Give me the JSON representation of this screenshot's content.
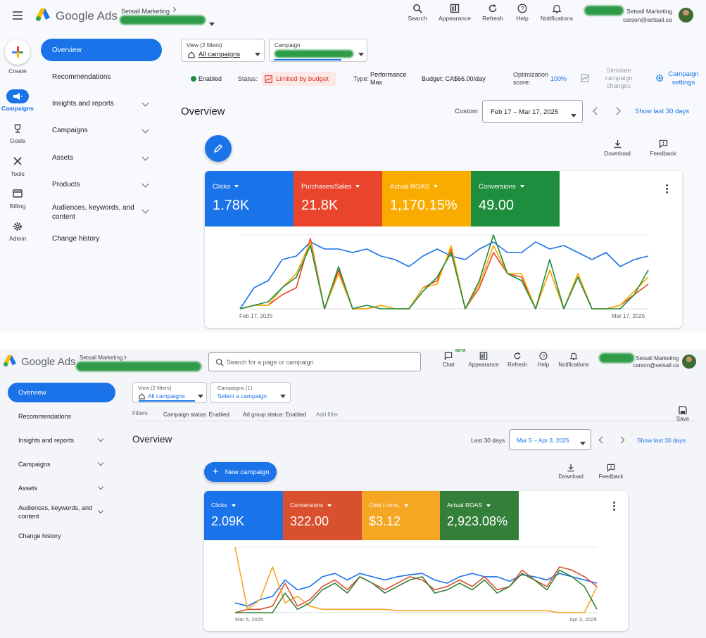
{
  "top": {
    "brand": "Google Ads",
    "account_name": "Setsail Marketing",
    "toolbar": [
      "Search",
      "Appearance",
      "Refresh",
      "Help",
      "Notifications"
    ],
    "user_name": "Setsail Marketing",
    "user_email": "carson@setsail.ca",
    "rail": [
      "Create",
      "Campaigns",
      "Goals",
      "Tools",
      "Billing",
      "Admin"
    ],
    "nav": {
      "overview": "Overview",
      "recommendations": "Recommendations",
      "insights": "Insights and reports",
      "campaigns": "Campaigns",
      "assets": "Assets",
      "products": "Products",
      "audiences": "Audiences, keywords, and content",
      "change_history": "Change history"
    },
    "view_filter": {
      "label": "View (2 filters)",
      "value": "All campaigns"
    },
    "campaign_select": {
      "label": "Campaign"
    },
    "status_row": {
      "enabled": "Enabled",
      "status_label": "Status:",
      "status_value": "Limited by budget",
      "type_label": "Type:",
      "type_value": "Performance Max",
      "budget": "Budget: CA$66.00/day",
      "opt_label": "Optimization score:",
      "opt_value": "100%",
      "simulate": "Simulate campaign changes",
      "settings": "Campaign settings"
    },
    "overview_title": "Overview",
    "date_preset": "Custom",
    "date_range": "Feb 17 – Mar 17, 2025",
    "show_last": "Show last 30 days",
    "download": "Download",
    "feedback": "Feedback",
    "tiles": [
      {
        "label": "Clicks",
        "value": "1.78K",
        "color": "#1a73e8"
      },
      {
        "label": "Purchases/Sales",
        "value": "21.8K",
        "color": "#e8452c"
      },
      {
        "label": "Actual ROAS",
        "value": "1,170.15%",
        "color": "#f9ab00"
      },
      {
        "label": "Conversions",
        "value": "49.00",
        "color": "#1e8e3e"
      }
    ],
    "x_start": "Feb 17, 2025",
    "x_end": "Mar 17, 2025"
  },
  "bottom": {
    "brand": "Google Ads",
    "account_name": "Setsail Marketing",
    "search_placeholder": "Search for a page or campaign",
    "toolbar": [
      "Chat",
      "Appearance",
      "Refresh",
      "Help",
      "Notifications"
    ],
    "beta": "BETA",
    "user_name": "Setsail Marketing",
    "user_email": "carson@setsail.ca",
    "nav": {
      "overview": "Overview",
      "recommendations": "Recommendations",
      "insights": "Insights and reports",
      "campaigns": "Campaigns",
      "assets": "Assets",
      "audiences": "Audiences, keywords, and content",
      "change_history": "Change history"
    },
    "view_filter": {
      "label": "View (2 filters)",
      "value": "All campaigns"
    },
    "campaign_select": {
      "label": "Campaigns (1)",
      "value": "Select a campaign"
    },
    "filters_label": "Filters",
    "filter_chips": [
      "Campaign status: Enabled",
      "Ad group status: Enabled",
      "Add filter"
    ],
    "save": "Save",
    "overview_title": "Overview",
    "date_preset": "Last 30 days",
    "date_range": "Mar 5 – Apr 3, 2025",
    "show_last": "Show last 30 days",
    "new_campaign": "New campaign",
    "download": "Download",
    "feedback": "Feedback",
    "tiles": [
      {
        "label": "Clicks",
        "value": "2.09K",
        "color": "#1a73e8"
      },
      {
        "label": "Conversions",
        "value": "322.00",
        "color": "#d9502f"
      },
      {
        "label": "Cost / conv.",
        "value": "$3.12",
        "color": "#f5a623"
      },
      {
        "label": "Actual ROAS",
        "value": "2,923.08%",
        "color": "#34803a"
      }
    ],
    "x_start": "Mar 5, 2025",
    "x_end": "Apr 3, 2025"
  },
  "chart_data": [
    {
      "type": "line",
      "x_start": "Feb 17, 2025",
      "x_end": "Mar 17, 2025",
      "series": [
        {
          "name": "Clicks",
          "color": "#1a73e8",
          "values": [
            0,
            30,
            40,
            70,
            75,
            95,
            85,
            85,
            80,
            85,
            75,
            70,
            60,
            75,
            85,
            75,
            70,
            85,
            95,
            80,
            80,
            95,
            85,
            90,
            80,
            70,
            80,
            60,
            70,
            75
          ]
        },
        {
          "name": "Purchases/Sales",
          "color": "#e8452c",
          "values": [
            0,
            5,
            5,
            20,
            30,
            100,
            0,
            55,
            0,
            0,
            5,
            0,
            0,
            30,
            40,
            85,
            0,
            30,
            80,
            50,
            45,
            0,
            55,
            0,
            50,
            0,
            0,
            5,
            20,
            35
          ]
        },
        {
          "name": "Actual ROAS",
          "color": "#f9ab00",
          "values": [
            0,
            5,
            5,
            30,
            50,
            95,
            0,
            50,
            0,
            0,
            5,
            0,
            0,
            30,
            35,
            90,
            0,
            35,
            90,
            50,
            50,
            0,
            55,
            0,
            50,
            0,
            0,
            5,
            25,
            45
          ]
        },
        {
          "name": "Conversions",
          "color": "#1e8e3e",
          "values": [
            0,
            5,
            10,
            30,
            45,
            90,
            0,
            60,
            0,
            5,
            0,
            0,
            0,
            25,
            45,
            80,
            0,
            40,
            105,
            50,
            40,
            0,
            70,
            0,
            45,
            0,
            0,
            0,
            20,
            55
          ]
        }
      ]
    },
    {
      "type": "line",
      "x_start": "Mar 5, 2025",
      "x_end": "Apr 3, 2025",
      "series": [
        {
          "name": "Clicks",
          "color": "#1a73e8",
          "values": [
            15,
            10,
            20,
            25,
            50,
            35,
            40,
            55,
            60,
            50,
            60,
            55,
            50,
            55,
            58,
            60,
            50,
            45,
            55,
            60,
            55,
            55,
            48,
            58,
            55,
            50,
            60,
            55,
            50,
            45
          ]
        },
        {
          "name": "Conversions",
          "color": "#d9502f",
          "values": [
            0,
            5,
            5,
            10,
            45,
            10,
            20,
            40,
            50,
            35,
            55,
            45,
            35,
            45,
            55,
            50,
            35,
            40,
            50,
            40,
            55,
            35,
            40,
            65,
            50,
            40,
            70,
            65,
            55,
            40
          ]
        },
        {
          "name": "Cost / conv.",
          "color": "#f5a623",
          "values": [
            100,
            5,
            20,
            70,
            15,
            25,
            10,
            5,
            5,
            5,
            5,
            5,
            5,
            3,
            3,
            3,
            3,
            3,
            3,
            3,
            3,
            3,
            3,
            3,
            3,
            3,
            0,
            0,
            0,
            40
          ]
        },
        {
          "name": "Actual ROAS",
          "color": "#34803a",
          "values": [
            0,
            0,
            0,
            0,
            30,
            5,
            15,
            35,
            45,
            30,
            55,
            45,
            30,
            40,
            50,
            55,
            30,
            35,
            45,
            35,
            50,
            30,
            40,
            60,
            50,
            35,
            65,
            55,
            40,
            5
          ]
        }
      ]
    }
  ]
}
